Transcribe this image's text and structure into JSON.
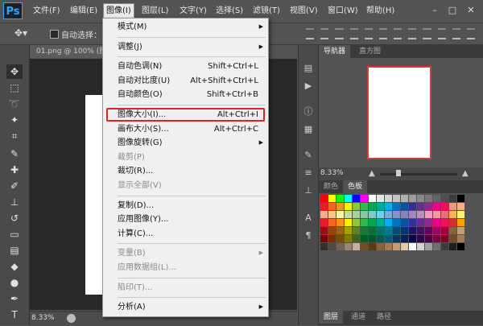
{
  "app": {
    "logo": "Ps"
  },
  "menubar": [
    {
      "label": "文件(F)"
    },
    {
      "label": "编辑(E)"
    },
    {
      "label": "图像(I)"
    },
    {
      "label": "图层(L)"
    },
    {
      "label": "文字(Y)"
    },
    {
      "label": "选择(S)"
    },
    {
      "label": "滤镜(T)"
    },
    {
      "label": "视图(V)"
    },
    {
      "label": "窗口(W)"
    },
    {
      "label": "帮助(H)"
    }
  ],
  "window_controls": {
    "minimize": "–",
    "restore": "□",
    "close": "✕"
  },
  "options_bar": {
    "tool_icon": "move-icon",
    "auto_select_label": "自动选择："
  },
  "document": {
    "tab_title": "01.png @ 100% (图",
    "zoom": "8.33%"
  },
  "dropdown": {
    "items": [
      {
        "label": "模式(M)",
        "submenu": true
      },
      {
        "sep": true
      },
      {
        "label": "调整(J)",
        "submenu": true
      },
      {
        "sep": true
      },
      {
        "label": "自动色调(N)",
        "shortcut": "Shift+Ctrl+L"
      },
      {
        "label": "自动对比度(U)",
        "shortcut": "Alt+Shift+Ctrl+L"
      },
      {
        "label": "自动颜色(O)",
        "shortcut": "Shift+Ctrl+B"
      },
      {
        "sep": true
      },
      {
        "label": "图像大小(I)...",
        "shortcut": "Alt+Ctrl+I",
        "highlighted": true
      },
      {
        "label": "画布大小(S)...",
        "shortcut": "Alt+Ctrl+C"
      },
      {
        "label": "图像旋转(G)",
        "submenu": true
      },
      {
        "label": "裁剪(P)",
        "disabled": true
      },
      {
        "label": "裁切(R)..."
      },
      {
        "label": "显示全部(V)",
        "disabled": true
      },
      {
        "sep": true
      },
      {
        "label": "复制(D)..."
      },
      {
        "label": "应用图像(Y)..."
      },
      {
        "label": "计算(C)..."
      },
      {
        "sep": true
      },
      {
        "label": "变量(B)",
        "submenu": true,
        "disabled": true
      },
      {
        "label": "应用数据组(L)...",
        "disabled": true
      },
      {
        "sep": true
      },
      {
        "label": "陷印(T)...",
        "disabled": true
      },
      {
        "sep": true
      },
      {
        "label": "分析(A)",
        "submenu": true
      }
    ]
  },
  "panels": {
    "navigator_tabs": [
      "导航器",
      "直方图"
    ],
    "navigator_zoom": "8.33%",
    "swatch_tabs": [
      "颜色",
      "色板"
    ],
    "bottom_tabs": [
      "图层",
      "通道",
      "路径"
    ]
  },
  "swatch_colors": [
    "#ff0000",
    "#ffff00",
    "#00ff00",
    "#00ffff",
    "#0000ff",
    "#ff00ff",
    "#ffffff",
    "#e6e6e6",
    "#d4d4d4",
    "#c3c3c3",
    "#b0b0b0",
    "#9c9c9c",
    "#898989",
    "#767676",
    "#636363",
    "#4f4f4f",
    "#3c3c3c",
    "#000000",
    "#ee1d24",
    "#f26522",
    "#f7941d",
    "#fff200",
    "#8dc63f",
    "#39b54a",
    "#00a651",
    "#00a99d",
    "#00aeef",
    "#0072bc",
    "#0054a6",
    "#2e3192",
    "#662d91",
    "#92278f",
    "#ec008c",
    "#ed145b",
    "#f7977a",
    "#fbad82",
    "#f9ad81",
    "#fdc68a",
    "#fff79a",
    "#c4df9b",
    "#a3d39c",
    "#82ca9d",
    "#7bcdc8",
    "#6dcff6",
    "#7ea7d8",
    "#8493ca",
    "#8882be",
    "#a187be",
    "#bc8dbf",
    "#f49ac2",
    "#f6989d",
    "#e57373",
    "#ffb74d",
    "#fff176",
    "#ed1c24",
    "#f26522",
    "#f7941d",
    "#fff200",
    "#8dc73f",
    "#39b54a",
    "#00a651",
    "#00a99d",
    "#00aeef",
    "#0072bc",
    "#0054a6",
    "#2e3192",
    "#662d91",
    "#92278f",
    "#ec008c",
    "#ed145b",
    "#d32f2f",
    "#ffa000",
    "#9e0b0f",
    "#a0410d",
    "#a36209",
    "#aba000",
    "#598527",
    "#1a7b30",
    "#007236",
    "#00746b",
    "#0076a3",
    "#004b80",
    "#003471",
    "#1b1464",
    "#440e62",
    "#630460",
    "#9e005d",
    "#9e0039",
    "#8c6239",
    "#c69c6d",
    "#790000",
    "#7b2e00",
    "#7d4900",
    "#827b00",
    "#406618",
    "#005e20",
    "#005826",
    "#005952",
    "#005b7f",
    "#003663",
    "#002157",
    "#0d004c",
    "#32004b",
    "#4b0049",
    "#7b0046",
    "#7a0026",
    "#754c24",
    "#a67c52",
    "#362f2d",
    "#534741",
    "#736357",
    "#998675",
    "#c7b299",
    "#754c24",
    "#603913",
    "#8c6239",
    "#a67c52",
    "#c69c6d",
    "#e3c9a3",
    "#ffffff",
    "#d2d2d2",
    "#a0a0a0",
    "#6e6e6e",
    "#3c3c3c",
    "#1e1e1e",
    "#000000"
  ]
}
